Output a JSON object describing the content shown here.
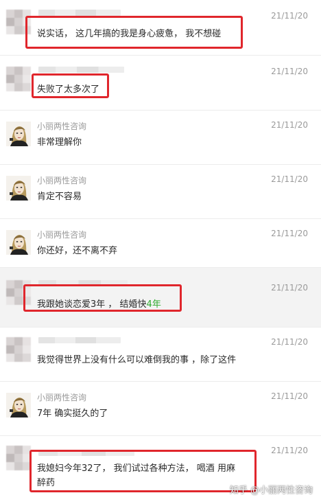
{
  "messages": [
    {
      "sender": "",
      "time": "21/11/20",
      "text": "说实话， 这几年搞的我是身心疲惫， 我不想碰",
      "highlighted": true
    },
    {
      "sender": "",
      "time": "21/11/20",
      "text": "失败了太多次了",
      "highlighted": true
    },
    {
      "sender": "小丽两性咨询",
      "time": "21/11/20",
      "text": "非常理解你",
      "highlighted": false
    },
    {
      "sender": "小丽两性咨询",
      "time": "21/11/20",
      "text": "肯定不容易",
      "highlighted": false
    },
    {
      "sender": "小丽两性咨询",
      "time": "21/11/20",
      "text": "你还好，还不离不弃",
      "highlighted": false
    },
    {
      "sender": "",
      "time": "21/11/20",
      "text_before": "我跟她谈恋爱3年 ， 结婚快",
      "text_green": "4年",
      "highlighted": true
    },
    {
      "sender": "",
      "time": "21/11/20",
      "text": "我觉得世界上没有什么可以难倒我的事 ，除了这件",
      "highlighted": false
    },
    {
      "sender": "小丽两性咨询",
      "time": "21/11/20",
      "text": "7年 确实挺久的了",
      "highlighted": false
    },
    {
      "sender": "",
      "time": "21/11/20",
      "text_line1": "我媳妇今年32了， 我们试过各种方法， 喝酒 用麻",
      "text_line2": "醉药",
      "highlighted": true
    }
  ],
  "watermark": "知乎 @小丽两性咨询",
  "colors": {
    "highlight_border": "#e0262c",
    "green_text": "#2eaa2e",
    "meta_gray": "#9a9a9a",
    "shaded_row": "#f3f3f3"
  },
  "icons": {
    "user_avatar": "blurred-avatar",
    "consultant_avatar": "consultant-avatar"
  }
}
